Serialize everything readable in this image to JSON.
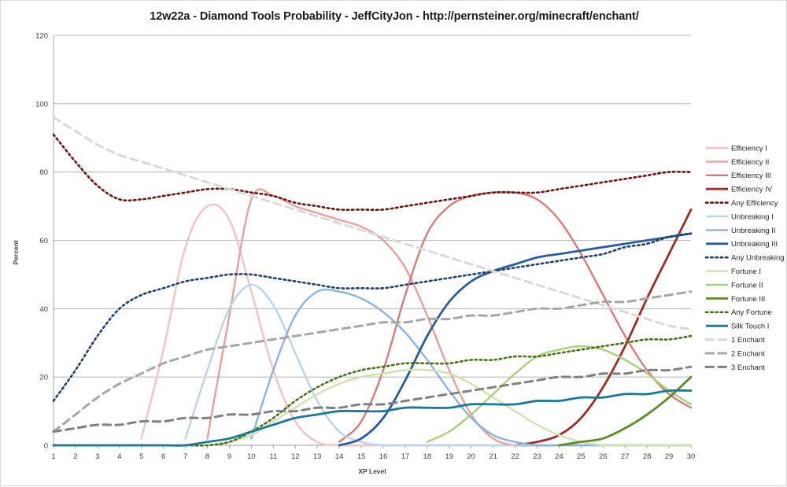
{
  "chart_data": {
    "type": "line",
    "title": "12w22a - Diamond Tools Probability - JeffCityJon - http://pernsteiner.org/minecraft/enchant/",
    "xlabel": "XP Level",
    "ylabel": "Percent",
    "xlim": [
      1,
      30
    ],
    "ylim": [
      0,
      120
    ],
    "ytick_step": 20,
    "yticks": [
      "0",
      "20",
      "40",
      "60",
      "80",
      "100",
      "120"
    ],
    "xticks": [
      "1",
      "2",
      "3",
      "4",
      "5",
      "6",
      "7",
      "8",
      "9",
      "10",
      "11",
      "12",
      "13",
      "14",
      "15",
      "16",
      "17",
      "18",
      "19",
      "20",
      "21",
      "22",
      "23",
      "24",
      "25",
      "26",
      "27",
      "28",
      "29",
      "30"
    ],
    "grid": "horizontal",
    "legend_position": "right",
    "x": [
      1,
      2,
      3,
      4,
      5,
      6,
      7,
      8,
      9,
      10,
      11,
      12,
      13,
      14,
      15,
      16,
      17,
      18,
      19,
      20,
      21,
      22,
      23,
      24,
      25,
      26,
      27,
      28,
      29,
      30
    ],
    "series": [
      {
        "name": "Efficiency I",
        "color": "#f2c3c0",
        "width": 2.4,
        "dash": "none",
        "values": [
          null,
          null,
          null,
          null,
          2,
          28,
          58,
          70,
          66,
          45,
          22,
          7,
          1,
          0,
          0,
          0,
          0,
          0,
          0,
          0,
          0,
          0,
          0,
          0,
          0,
          0,
          0,
          0,
          0,
          0
        ]
      },
      {
        "name": "Efficiency II",
        "color": "#e8a09c",
        "width": 2.4,
        "dash": "none",
        "values": [
          null,
          null,
          null,
          null,
          null,
          null,
          null,
          2,
          38,
          72,
          73,
          70,
          68,
          66,
          64,
          60,
          52,
          38,
          22,
          9,
          2,
          0,
          0,
          0,
          0,
          0,
          0,
          0,
          0,
          0
        ]
      },
      {
        "name": "Efficiency III",
        "color": "#d97a77",
        "width": 2.4,
        "dash": "none",
        "values": [
          null,
          null,
          null,
          null,
          null,
          null,
          null,
          null,
          null,
          null,
          null,
          null,
          null,
          1,
          7,
          22,
          44,
          62,
          70,
          73,
          74,
          74,
          72,
          66,
          56,
          44,
          32,
          22,
          15,
          11
        ]
      },
      {
        "name": "Efficiency IV",
        "color": "#9e2b25",
        "width": 2.8,
        "dash": "none",
        "values": [
          null,
          null,
          null,
          null,
          null,
          null,
          null,
          null,
          null,
          null,
          null,
          null,
          null,
          null,
          null,
          null,
          null,
          null,
          null,
          null,
          null,
          0,
          1,
          3,
          8,
          17,
          29,
          43,
          56,
          69
        ]
      },
      {
        "name": "Any Efficiency",
        "color": "#6b1512",
        "width": 2.6,
        "dash": "dotted",
        "values": [
          91,
          83,
          76,
          72,
          72,
          73,
          74,
          75,
          75,
          74,
          73,
          71,
          70,
          69,
          69,
          69,
          70,
          71,
          72,
          73,
          74,
          74,
          74,
          75,
          76,
          77,
          78,
          79,
          80,
          80
        ]
      },
      {
        "name": "Unbreaking I",
        "color": "#b9d3ef",
        "width": 2.4,
        "dash": "none",
        "values": [
          null,
          null,
          null,
          null,
          null,
          null,
          2,
          22,
          40,
          47,
          41,
          27,
          13,
          4,
          1,
          0,
          0,
          0,
          0,
          0,
          0,
          0,
          0,
          0,
          0,
          0,
          0,
          0,
          0,
          0
        ]
      },
      {
        "name": "Unbreaking II",
        "color": "#8ab4e0",
        "width": 2.4,
        "dash": "none",
        "values": [
          null,
          null,
          null,
          null,
          null,
          null,
          null,
          null,
          null,
          2,
          22,
          38,
          45,
          45,
          43,
          39,
          33,
          25,
          16,
          8,
          3,
          1,
          0,
          0,
          0,
          0,
          0,
          0,
          0,
          0
        ]
      },
      {
        "name": "Unbreaking III",
        "color": "#2a5d9e",
        "width": 2.8,
        "dash": "none",
        "values": [
          null,
          null,
          null,
          null,
          null,
          null,
          null,
          null,
          null,
          null,
          null,
          null,
          null,
          0,
          2,
          8,
          19,
          32,
          42,
          48,
          51,
          53,
          55,
          56,
          57,
          58,
          59,
          60,
          61,
          62
        ]
      },
      {
        "name": "Any Unbreaking",
        "color": "#1f3f73",
        "width": 2.6,
        "dash": "dotted",
        "values": [
          13,
          22,
          32,
          40,
          44,
          46,
          48,
          49,
          50,
          50,
          49,
          48,
          47,
          46,
          46,
          46,
          47,
          48,
          49,
          50,
          51,
          52,
          53,
          54,
          55,
          56,
          58,
          59,
          61,
          62
        ]
      },
      {
        "name": "Fortune I",
        "color": "#cde3b0",
        "width": 2.4,
        "dash": "none",
        "values": [
          null,
          null,
          null,
          null,
          null,
          null,
          null,
          0,
          1,
          3,
          7,
          11,
          15,
          18,
          20,
          21,
          22,
          22,
          21,
          18,
          14,
          10,
          6,
          3,
          1,
          0,
          0,
          0,
          0,
          0
        ]
      },
      {
        "name": "Fortune II",
        "color": "#aacf7c",
        "width": 2.4,
        "dash": "none",
        "values": [
          null,
          null,
          null,
          null,
          null,
          null,
          null,
          null,
          null,
          null,
          null,
          null,
          null,
          null,
          null,
          null,
          null,
          1,
          4,
          9,
          15,
          21,
          26,
          28,
          29,
          28,
          25,
          21,
          16,
          12
        ]
      },
      {
        "name": "Fortune III",
        "color": "#5d8a2a",
        "width": 2.8,
        "dash": "none",
        "values": [
          null,
          null,
          null,
          null,
          null,
          null,
          null,
          null,
          null,
          null,
          null,
          null,
          null,
          null,
          null,
          null,
          null,
          null,
          null,
          null,
          null,
          null,
          null,
          0,
          1,
          2,
          5,
          9,
          14,
          20
        ]
      },
      {
        "name": "Any Fortune",
        "color": "#4a7019",
        "width": 2.6,
        "dash": "dotted",
        "values": [
          0,
          0,
          0,
          0,
          0,
          0,
          0,
          0,
          1,
          4,
          8,
          13,
          17,
          20,
          22,
          23,
          24,
          24,
          24,
          25,
          25,
          26,
          26,
          27,
          28,
          29,
          30,
          31,
          31,
          32
        ]
      },
      {
        "name": "Silk Touch I",
        "color": "#1a7a96",
        "width": 2.8,
        "dash": "none",
        "values": [
          0,
          0,
          0,
          0,
          0,
          0,
          0,
          1,
          2,
          4,
          6,
          8,
          9,
          10,
          10,
          10,
          11,
          11,
          11,
          12,
          12,
          12,
          13,
          13,
          14,
          14,
          15,
          15,
          16,
          16
        ]
      },
      {
        "name": "1 Enchant",
        "color": "#d9d9d9",
        "width": 3.0,
        "dash": "dashed",
        "values": [
          96,
          92,
          88,
          85,
          83,
          81,
          79,
          77,
          75,
          73,
          71,
          69,
          67,
          65,
          63,
          61,
          59,
          57,
          55,
          53,
          51,
          49,
          47,
          45,
          43,
          41,
          39,
          37,
          35,
          34
        ]
      },
      {
        "name": "2 Enchant",
        "color": "#a6a6a6",
        "width": 3.0,
        "dash": "dashed",
        "values": [
          4,
          9,
          14,
          18,
          21,
          24,
          26,
          28,
          29,
          30,
          31,
          32,
          33,
          34,
          35,
          36,
          36,
          37,
          37,
          38,
          38,
          39,
          40,
          40,
          41,
          42,
          42,
          43,
          44,
          45
        ]
      },
      {
        "name": "3 Enchant",
        "color": "#808080",
        "width": 3.0,
        "dash": "dashed",
        "values": [
          4,
          5,
          6,
          6,
          7,
          7,
          8,
          8,
          9,
          9,
          10,
          10,
          11,
          11,
          12,
          12,
          13,
          14,
          15,
          16,
          17,
          18,
          19,
          20,
          20,
          21,
          21,
          22,
          22,
          23
        ]
      }
    ]
  }
}
